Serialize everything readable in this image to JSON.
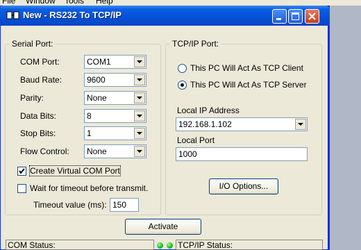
{
  "parent_menu": {
    "items": [
      "File",
      "Window",
      "Tools",
      "Help"
    ]
  },
  "window": {
    "title": "New - RS232 To TCP/IP"
  },
  "serial": {
    "group_title": "Serial Port:",
    "com_port": {
      "label": "COM Port:",
      "value": "COM1"
    },
    "baud_rate": {
      "label": "Baud Rate:",
      "value": "9600"
    },
    "parity": {
      "label": "Parity:",
      "value": "None"
    },
    "data_bits": {
      "label": "Data Bits:",
      "value": "8"
    },
    "stop_bits": {
      "label": "Stop Bits:",
      "value": "1"
    },
    "flow_control": {
      "label": "Flow Control:",
      "value": "None"
    },
    "create_virtual": {
      "label": "Create Virtual COM Port",
      "checked": true
    },
    "wait_timeout": {
      "label": "Wait for timeout before transmit.",
      "checked": false
    },
    "timeout": {
      "label": "Timeout value (ms):",
      "value": "150"
    }
  },
  "tcp": {
    "group_title": "TCP/IP Port:",
    "client_label": "This PC Will Act As TCP Client",
    "server_label": "This PC Will Act As TCP Server",
    "mode": "server",
    "local_ip_label": "Local IP Address",
    "local_ip_value": "192.168.1.102",
    "local_port_label": "Local Port",
    "local_port_value": "1000",
    "io_button": "I/O Options..."
  },
  "activate_button": "Activate",
  "status": {
    "com_label": "COM Status:",
    "tcp_label": "TCP/IP Status:",
    "led_color": "#17b817"
  },
  "colors": {
    "title_bar": "#0a5fe0",
    "face": "#ece9d8",
    "close_button": "#c4401c"
  }
}
